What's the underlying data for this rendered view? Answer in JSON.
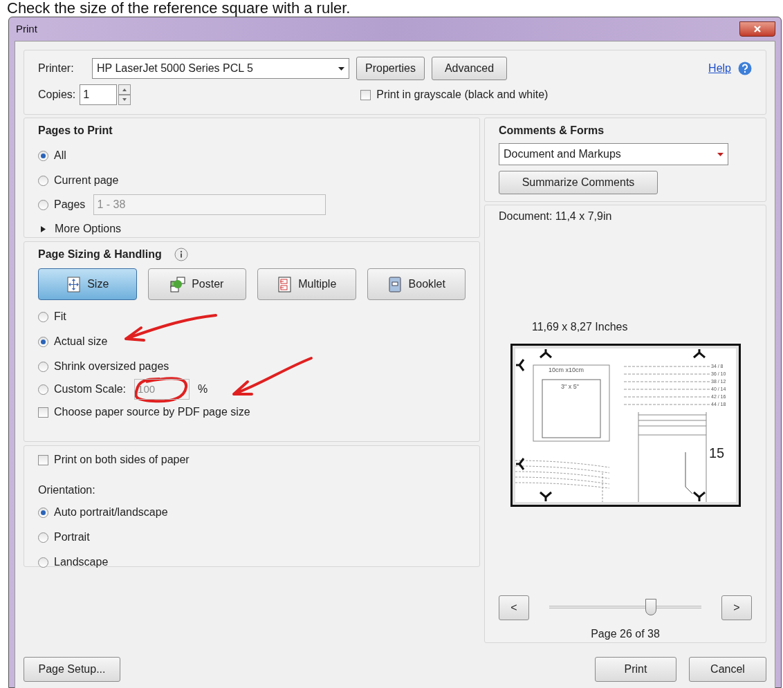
{
  "caption": "Check the size of the reference square with a ruler.",
  "window": {
    "title": "Print"
  },
  "printer": {
    "label": "Printer:",
    "value": "HP LaserJet 5000 Series PCL 5"
  },
  "properties_button": "Properties",
  "advanced_button": "Advanced",
  "help_link": "Help",
  "copies": {
    "label": "Copies:",
    "value": "1"
  },
  "grayscale": {
    "label": "Print in grayscale (black and white)",
    "checked": false
  },
  "pages_to_print": {
    "title": "Pages to Print",
    "options": [
      {
        "label": "All",
        "selected": true
      },
      {
        "label": "Current page",
        "selected": false
      },
      {
        "label": "Pages",
        "selected": false,
        "value": "1 - 38",
        "disabled": true
      }
    ],
    "more_options": "More Options",
    "expanded": false
  },
  "page_sizing": {
    "title": "Page Sizing & Handling",
    "modes": [
      {
        "kind": "size",
        "label": "Size",
        "selected": true
      },
      {
        "kind": "poster",
        "label": "Poster",
        "selected": false
      },
      {
        "kind": "multiple",
        "label": "Multiple",
        "selected": false
      },
      {
        "kind": "booklet",
        "label": "Booklet",
        "selected": false
      }
    ],
    "options": [
      {
        "label": "Fit",
        "selected": false
      },
      {
        "label": "Actual size",
        "selected": true
      },
      {
        "label": "Shrink oversized pages",
        "selected": false
      },
      {
        "label": "Custom Scale:",
        "selected": false,
        "value": "100",
        "suffix": "%",
        "disabled": true
      }
    ],
    "paper_source": {
      "label": "Choose paper source by PDF page size",
      "checked": false
    }
  },
  "both_sides": {
    "label": "Print on both sides of paper",
    "checked": false
  },
  "orientation": {
    "title": "Orientation:",
    "options": [
      {
        "label": "Auto portrait/landscape",
        "selected": true
      },
      {
        "label": "Portrait",
        "selected": false
      },
      {
        "label": "Landscape",
        "selected": false
      }
    ]
  },
  "comments_forms": {
    "title": "Comments & Forms",
    "value": "Document and Markups",
    "summarize_button": "Summarize Comments"
  },
  "preview": {
    "document": "Document: 11,4 x 7,9in",
    "paper": "11,69 x 8,27 Inches",
    "outer_label": "10cm x10cm",
    "inner_label": "3\" x 5\"",
    "sizes": [
      "34 / 8",
      "36 / 10",
      "38 / 12",
      "40 / 14",
      "42 / 16",
      "44 / 18"
    ],
    "page_number": "15",
    "prev": "<",
    "next": ">",
    "level": 0.67,
    "page": "Page 26 of 38"
  },
  "page_setup_button": "Page Setup...",
  "print_button": "Print",
  "cancel_button": "Cancel"
}
